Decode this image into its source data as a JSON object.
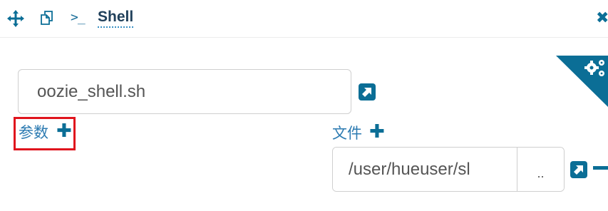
{
  "header": {
    "title": "Shell",
    "icons": {
      "move": "move-arrows-icon",
      "copy": "copy-icon",
      "prompt": "terminal-prompt-icon",
      "prompt_glyph": ">_",
      "close": "close-icon",
      "close_glyph": "✖"
    }
  },
  "script": {
    "value": "oozie_shell.sh"
  },
  "params": {
    "label": "参数",
    "add_glyph": "✚"
  },
  "files": {
    "label": "文件",
    "add_glyph": "✚",
    "path_value": "/user/hueuser/sl",
    "browse_label": ".."
  },
  "colors": {
    "accent": "#0b6e96",
    "label_blue": "#2b7ab1",
    "highlight_red": "#e0141d"
  }
}
